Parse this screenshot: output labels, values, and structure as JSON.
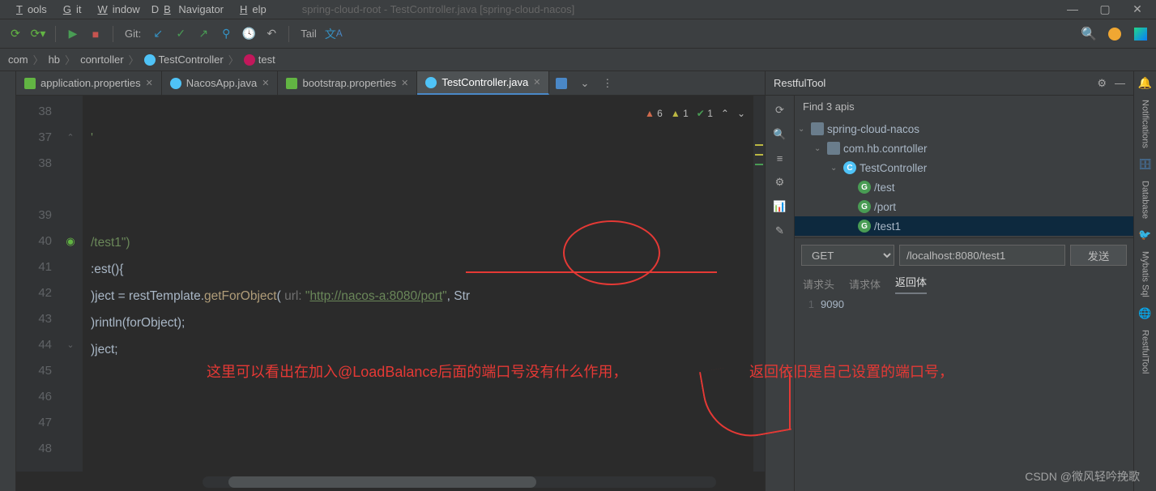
{
  "menu": {
    "tools": "Tools",
    "git": "Git",
    "window": "Window",
    "dbnav": "DB Navigator",
    "help": "Help"
  },
  "title": "spring-cloud-root - TestController.java [spring-cloud-nacos]",
  "crumbs": {
    "a": "com",
    "b": "hb",
    "c": "conrtoller",
    "d": "TestController",
    "e": "test"
  },
  "toolbar": {
    "git": "Git:",
    "tail": "Tail"
  },
  "tabs": {
    "t1": "application.properties",
    "t2": "NacosApp.java",
    "t3": "bootstrap.properties",
    "t4": "TestController.java"
  },
  "insp": {
    "err": "6",
    "warn": "1",
    "ok": "1"
  },
  "gutter": [
    "38",
    "37",
    "38",
    "",
    "39",
    "40",
    "41",
    "42",
    "43",
    "44",
    "45",
    "46",
    "47",
    "48"
  ],
  "code": {
    "l38": "",
    "l39a": "/test1\")",
    "l40": ":est(){",
    "l41a": ")ject = ",
    "l41b": "restTemplate",
    "l41c": ".",
    "l41d": "getForObject",
    "l41e": "( ",
    "l41p": "url: ",
    "l41q": "\"",
    "l41url": "http://nacos-a:8080/port",
    "l41r": "\"",
    "l41s": ", Str",
    "l42a": ")rintln(",
    "l42b": "forObject",
    "l42c": ");",
    "l43": ")ject;"
  },
  "rp": {
    "title": "RestfulTool",
    "find": "Find 3 apis",
    "n1": "spring-cloud-nacos",
    "n2": "com.hb.conrtoller",
    "n3": "TestController",
    "e1": "/test",
    "e2": "/port",
    "e3": "/test1",
    "method": "GET",
    "url": "/localhost:8080/test1",
    "send": "发送",
    "rt1": "请求头",
    "rt2": "请求体",
    "rt3": "返回体",
    "respLn": "1",
    "resp": "9090"
  },
  "vtabs": {
    "notif": "Notifications",
    "db": "Database",
    "mybatis": "Mybatis Sql",
    "rest": "RestfulTool"
  },
  "ann": {
    "text1": "这里可以看出在加入@LoadBalance后面的端口号没有什么作用，",
    "text2": "返回依旧是自己设置的端口号，"
  },
  "watermark": "CSDN @微风轻吟挽歌"
}
